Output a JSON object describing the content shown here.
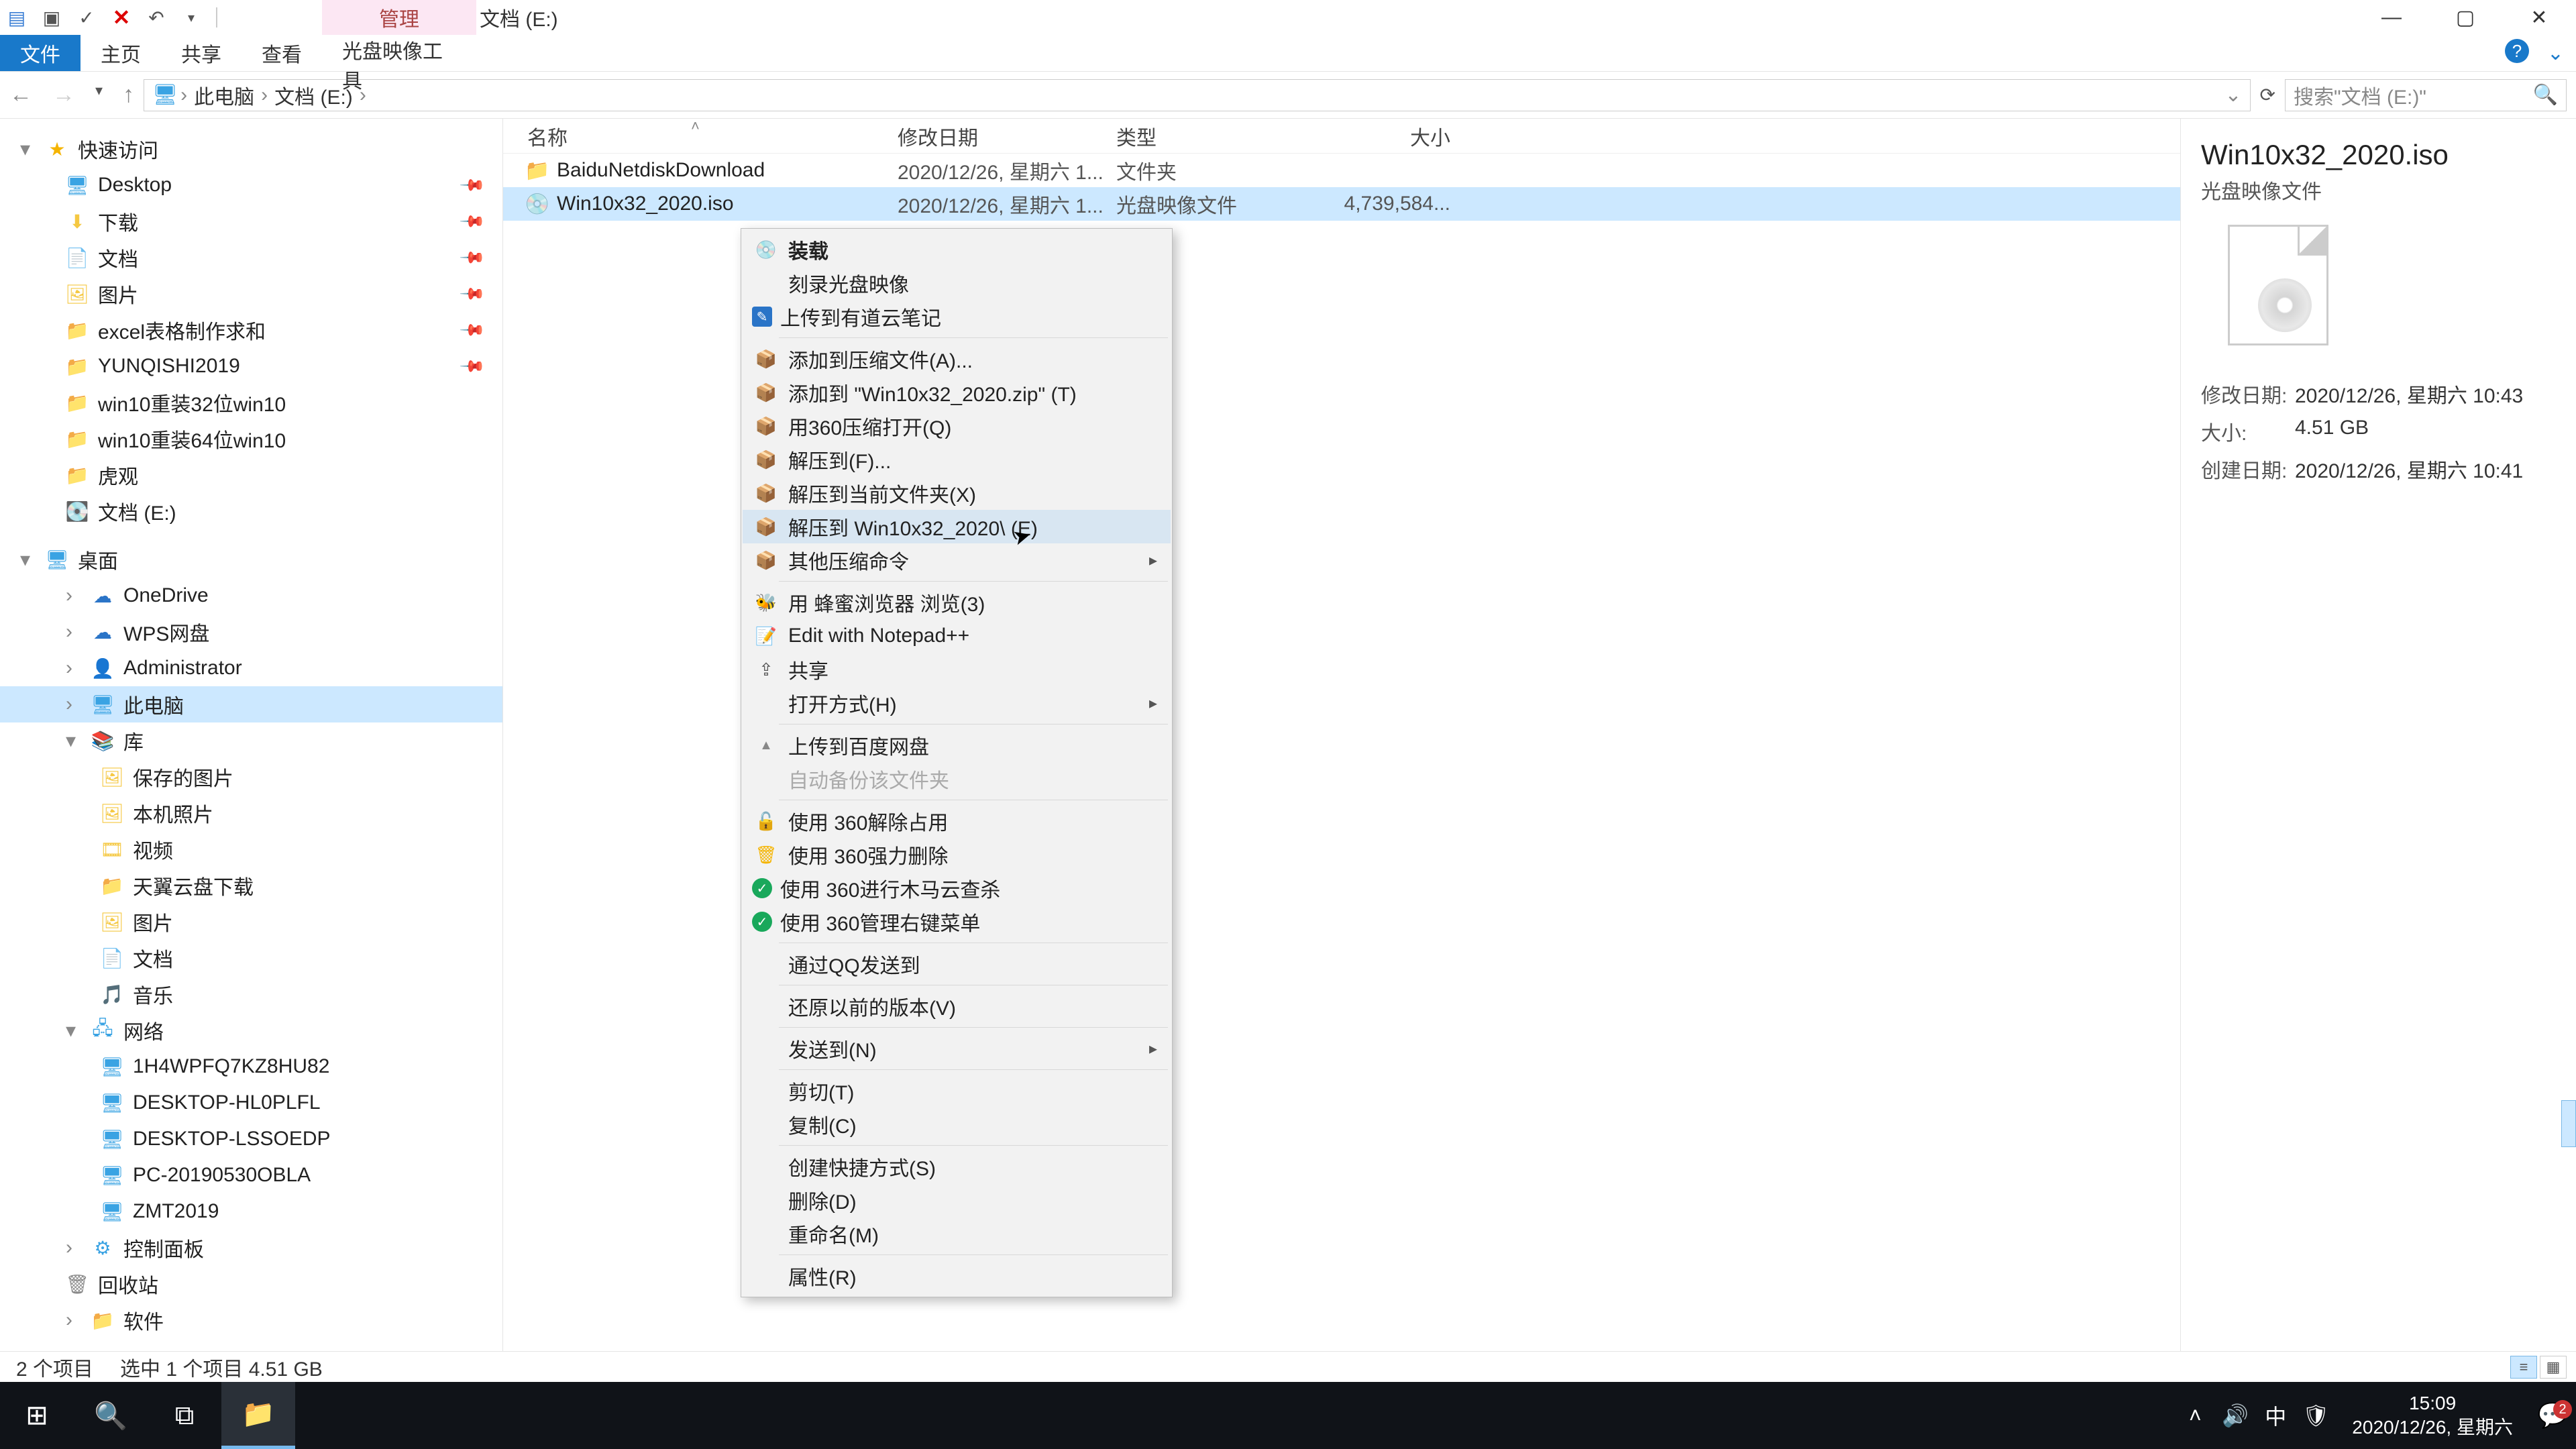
{
  "titlebar": {
    "manage_tab": "管理",
    "title": "文档 (E:)"
  },
  "ribbon": {
    "file": "文件",
    "home": "主页",
    "share": "共享",
    "view": "查看",
    "disk_tools": "光盘映像工具"
  },
  "breadcrumb": {
    "root": "此电脑",
    "drive": "文档 (E:)"
  },
  "search": {
    "placeholder": "搜索\"文档 (E:)\""
  },
  "columns": {
    "name": "名称",
    "date": "修改日期",
    "type": "类型",
    "size": "大小"
  },
  "rows": [
    {
      "name": "BaiduNetdiskDownload",
      "date": "2020/12/26, 星期六 1...",
      "type": "文件夹",
      "size": "",
      "icon": "folder"
    },
    {
      "name": "Win10x32_2020.iso",
      "date": "2020/12/26, 星期六 1...",
      "type": "光盘映像文件",
      "size": "4,739,584...",
      "icon": "iso"
    }
  ],
  "navtree": {
    "quick": "快速访问",
    "items_quick": [
      "Desktop",
      "下载",
      "文档",
      "图片",
      "excel表格制作求和",
      "YUNQISHI2019",
      "win10重装32位win10",
      "win10重装64位win10",
      "虎观",
      "文档 (E:)"
    ],
    "desktop": "桌面",
    "onedrive": "OneDrive",
    "wps": "WPS网盘",
    "admin": "Administrator",
    "pc": "此电脑",
    "lib": "库",
    "lib_items": [
      "保存的图片",
      "本机照片",
      "视频",
      "天翼云盘下载",
      "图片",
      "文档",
      "音乐"
    ],
    "network": "网络",
    "net_items": [
      "1H4WPFQ7KZ8HU82",
      "DESKTOP-HL0PLFL",
      "DESKTOP-LSSOEDP",
      "PC-20190530OBLA",
      "ZMT2019"
    ],
    "cp": "控制面板",
    "trash": "回收站",
    "soft": "软件"
  },
  "context_menu": {
    "mount": "装载",
    "burn": "刻录光盘映像",
    "youdao": "上传到有道云笔记",
    "add_zip": "添加到压缩文件(A)...",
    "add_zip_named": "添加到 \"Win10x32_2020.zip\" (T)",
    "open_360zip": "用360压缩打开(Q)",
    "extract_to": "解压到(F)...",
    "extract_here": "解压到当前文件夹(X)",
    "extract_named": "解压到 Win10x32_2020\\ (E)",
    "other_zip": "其他压缩命令",
    "honey": "用 蜂蜜浏览器 浏览(3)",
    "npp": "Edit with Notepad++",
    "share": "共享",
    "openwith": "打开方式(H)",
    "baidu": "上传到百度网盘",
    "auto_backup": "自动备份该文件夹",
    "u360_unlock": "使用 360解除占用",
    "u360_forcedel": "使用 360强力删除",
    "u360_scan": "使用 360进行木马云查杀",
    "u360_menu": "使用 360管理右键菜单",
    "qq_send": "通过QQ发送到",
    "restore": "还原以前的版本(V)",
    "sendto": "发送到(N)",
    "cut": "剪切(T)",
    "copy": "复制(C)",
    "shortcut": "创建快捷方式(S)",
    "delete": "删除(D)",
    "rename": "重命名(M)",
    "properties": "属性(R)"
  },
  "details": {
    "filename": "Win10x32_2020.iso",
    "filetype": "光盘映像文件",
    "mod_label": "修改日期:",
    "mod_value": "2020/12/26, 星期六 10:43",
    "size_label": "大小:",
    "size_value": "4.51 GB",
    "create_label": "创建日期:",
    "create_value": "2020/12/26, 星期六 10:41"
  },
  "statusbar": {
    "count": "2 个项目",
    "selected": "选中 1 个项目  4.51 GB"
  },
  "taskbar": {
    "time": "15:09",
    "date": "2020/12/26, 星期六",
    "ime": "中",
    "notif_count": "2"
  }
}
